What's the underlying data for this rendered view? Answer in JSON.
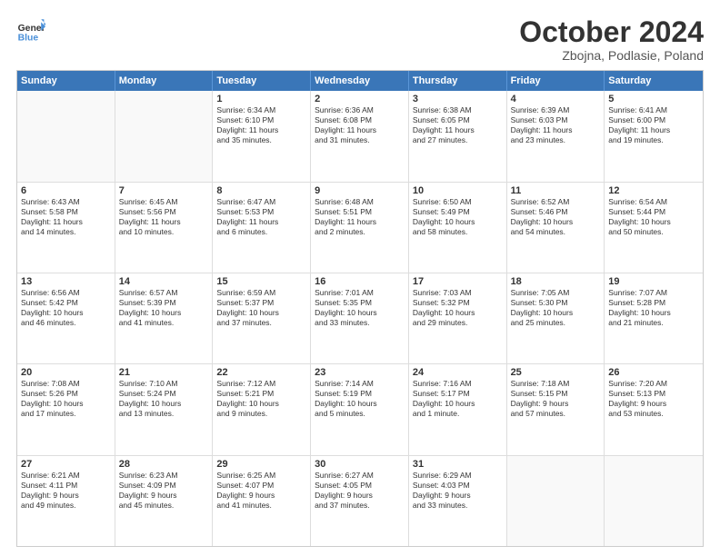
{
  "header": {
    "logo_general": "General",
    "logo_blue": "Blue",
    "month_title": "October 2024",
    "location": "Zbojna, Podlasie, Poland"
  },
  "weekdays": [
    "Sunday",
    "Monday",
    "Tuesday",
    "Wednesday",
    "Thursday",
    "Friday",
    "Saturday"
  ],
  "rows": [
    [
      {
        "day": "",
        "empty": true
      },
      {
        "day": "",
        "empty": true
      },
      {
        "day": "1",
        "lines": [
          "Sunrise: 6:34 AM",
          "Sunset: 6:10 PM",
          "Daylight: 11 hours",
          "and 35 minutes."
        ]
      },
      {
        "day": "2",
        "lines": [
          "Sunrise: 6:36 AM",
          "Sunset: 6:08 PM",
          "Daylight: 11 hours",
          "and 31 minutes."
        ]
      },
      {
        "day": "3",
        "lines": [
          "Sunrise: 6:38 AM",
          "Sunset: 6:05 PM",
          "Daylight: 11 hours",
          "and 27 minutes."
        ]
      },
      {
        "day": "4",
        "lines": [
          "Sunrise: 6:39 AM",
          "Sunset: 6:03 PM",
          "Daylight: 11 hours",
          "and 23 minutes."
        ]
      },
      {
        "day": "5",
        "lines": [
          "Sunrise: 6:41 AM",
          "Sunset: 6:00 PM",
          "Daylight: 11 hours",
          "and 19 minutes."
        ]
      }
    ],
    [
      {
        "day": "6",
        "lines": [
          "Sunrise: 6:43 AM",
          "Sunset: 5:58 PM",
          "Daylight: 11 hours",
          "and 14 minutes."
        ]
      },
      {
        "day": "7",
        "lines": [
          "Sunrise: 6:45 AM",
          "Sunset: 5:56 PM",
          "Daylight: 11 hours",
          "and 10 minutes."
        ]
      },
      {
        "day": "8",
        "lines": [
          "Sunrise: 6:47 AM",
          "Sunset: 5:53 PM",
          "Daylight: 11 hours",
          "and 6 minutes."
        ]
      },
      {
        "day": "9",
        "lines": [
          "Sunrise: 6:48 AM",
          "Sunset: 5:51 PM",
          "Daylight: 11 hours",
          "and 2 minutes."
        ]
      },
      {
        "day": "10",
        "lines": [
          "Sunrise: 6:50 AM",
          "Sunset: 5:49 PM",
          "Daylight: 10 hours",
          "and 58 minutes."
        ]
      },
      {
        "day": "11",
        "lines": [
          "Sunrise: 6:52 AM",
          "Sunset: 5:46 PM",
          "Daylight: 10 hours",
          "and 54 minutes."
        ]
      },
      {
        "day": "12",
        "lines": [
          "Sunrise: 6:54 AM",
          "Sunset: 5:44 PM",
          "Daylight: 10 hours",
          "and 50 minutes."
        ]
      }
    ],
    [
      {
        "day": "13",
        "lines": [
          "Sunrise: 6:56 AM",
          "Sunset: 5:42 PM",
          "Daylight: 10 hours",
          "and 46 minutes."
        ]
      },
      {
        "day": "14",
        "lines": [
          "Sunrise: 6:57 AM",
          "Sunset: 5:39 PM",
          "Daylight: 10 hours",
          "and 41 minutes."
        ]
      },
      {
        "day": "15",
        "lines": [
          "Sunrise: 6:59 AM",
          "Sunset: 5:37 PM",
          "Daylight: 10 hours",
          "and 37 minutes."
        ]
      },
      {
        "day": "16",
        "lines": [
          "Sunrise: 7:01 AM",
          "Sunset: 5:35 PM",
          "Daylight: 10 hours",
          "and 33 minutes."
        ]
      },
      {
        "day": "17",
        "lines": [
          "Sunrise: 7:03 AM",
          "Sunset: 5:32 PM",
          "Daylight: 10 hours",
          "and 29 minutes."
        ]
      },
      {
        "day": "18",
        "lines": [
          "Sunrise: 7:05 AM",
          "Sunset: 5:30 PM",
          "Daylight: 10 hours",
          "and 25 minutes."
        ]
      },
      {
        "day": "19",
        "lines": [
          "Sunrise: 7:07 AM",
          "Sunset: 5:28 PM",
          "Daylight: 10 hours",
          "and 21 minutes."
        ]
      }
    ],
    [
      {
        "day": "20",
        "lines": [
          "Sunrise: 7:08 AM",
          "Sunset: 5:26 PM",
          "Daylight: 10 hours",
          "and 17 minutes."
        ]
      },
      {
        "day": "21",
        "lines": [
          "Sunrise: 7:10 AM",
          "Sunset: 5:24 PM",
          "Daylight: 10 hours",
          "and 13 minutes."
        ]
      },
      {
        "day": "22",
        "lines": [
          "Sunrise: 7:12 AM",
          "Sunset: 5:21 PM",
          "Daylight: 10 hours",
          "and 9 minutes."
        ]
      },
      {
        "day": "23",
        "lines": [
          "Sunrise: 7:14 AM",
          "Sunset: 5:19 PM",
          "Daylight: 10 hours",
          "and 5 minutes."
        ]
      },
      {
        "day": "24",
        "lines": [
          "Sunrise: 7:16 AM",
          "Sunset: 5:17 PM",
          "Daylight: 10 hours",
          "and 1 minute."
        ]
      },
      {
        "day": "25",
        "lines": [
          "Sunrise: 7:18 AM",
          "Sunset: 5:15 PM",
          "Daylight: 9 hours",
          "and 57 minutes."
        ]
      },
      {
        "day": "26",
        "lines": [
          "Sunrise: 7:20 AM",
          "Sunset: 5:13 PM",
          "Daylight: 9 hours",
          "and 53 minutes."
        ]
      }
    ],
    [
      {
        "day": "27",
        "lines": [
          "Sunrise: 6:21 AM",
          "Sunset: 4:11 PM",
          "Daylight: 9 hours",
          "and 49 minutes."
        ]
      },
      {
        "day": "28",
        "lines": [
          "Sunrise: 6:23 AM",
          "Sunset: 4:09 PM",
          "Daylight: 9 hours",
          "and 45 minutes."
        ]
      },
      {
        "day": "29",
        "lines": [
          "Sunrise: 6:25 AM",
          "Sunset: 4:07 PM",
          "Daylight: 9 hours",
          "and 41 minutes."
        ]
      },
      {
        "day": "30",
        "lines": [
          "Sunrise: 6:27 AM",
          "Sunset: 4:05 PM",
          "Daylight: 9 hours",
          "and 37 minutes."
        ]
      },
      {
        "day": "31",
        "lines": [
          "Sunrise: 6:29 AM",
          "Sunset: 4:03 PM",
          "Daylight: 9 hours",
          "and 33 minutes."
        ]
      },
      {
        "day": "",
        "empty": true
      },
      {
        "day": "",
        "empty": true
      }
    ]
  ]
}
